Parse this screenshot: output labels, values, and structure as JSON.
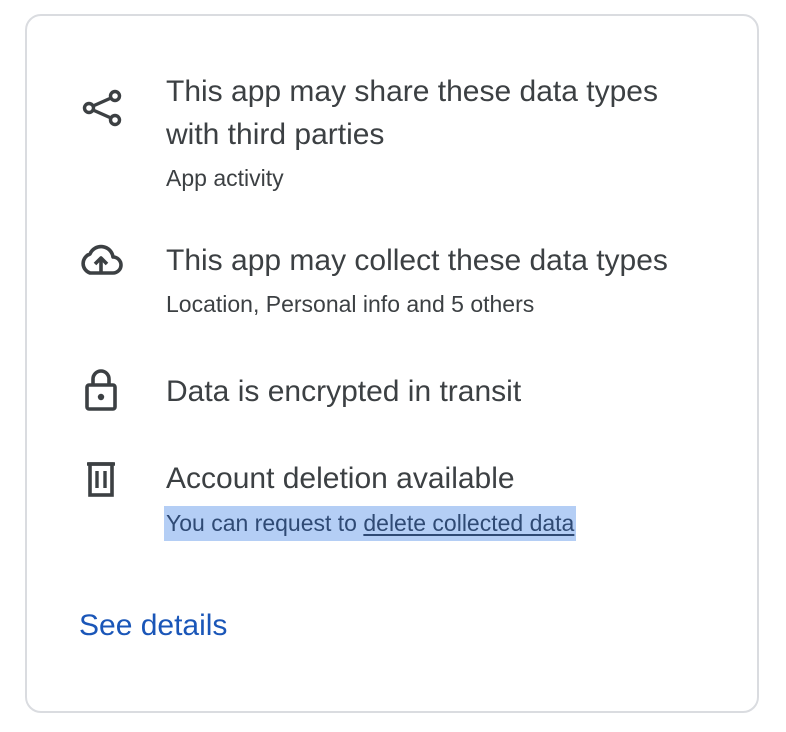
{
  "items": [
    {
      "icon": "share-icon",
      "title": "This app may share these data types with third parties",
      "subtitle": "App activity"
    },
    {
      "icon": "cloud-upload-icon",
      "title": "This app may collect these data types",
      "subtitle": "Location, Personal info and 5 others"
    },
    {
      "icon": "lock-icon",
      "title": "Data is encrypted in transit"
    },
    {
      "icon": "trash-icon",
      "title": "Account deletion available",
      "subtitle_prefix": "You can request to ",
      "subtitle_link": "delete collected data"
    }
  ],
  "see_details": "See details",
  "colors": {
    "link": "#1a56b8",
    "text": "#3c4043",
    "border": "#dadce0",
    "selection": "#b4cef5"
  }
}
